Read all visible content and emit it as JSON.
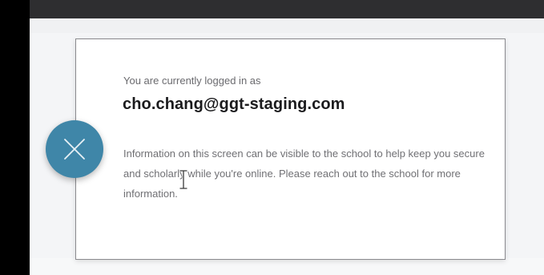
{
  "session_notice": {
    "intro": "You are currently logged in as",
    "email": "cho.chang@ggt-staging.com",
    "info": "Information on this screen can be visible to the school to help keep you secure and scholarly while you're online. Please reach out to the school for more information."
  },
  "close_button": {
    "icon": "close-icon"
  },
  "colors": {
    "accent": "#3f86a8",
    "top_bar": "#2e2e30",
    "left_bar": "#000000",
    "card_border": "#8a8a8e"
  }
}
